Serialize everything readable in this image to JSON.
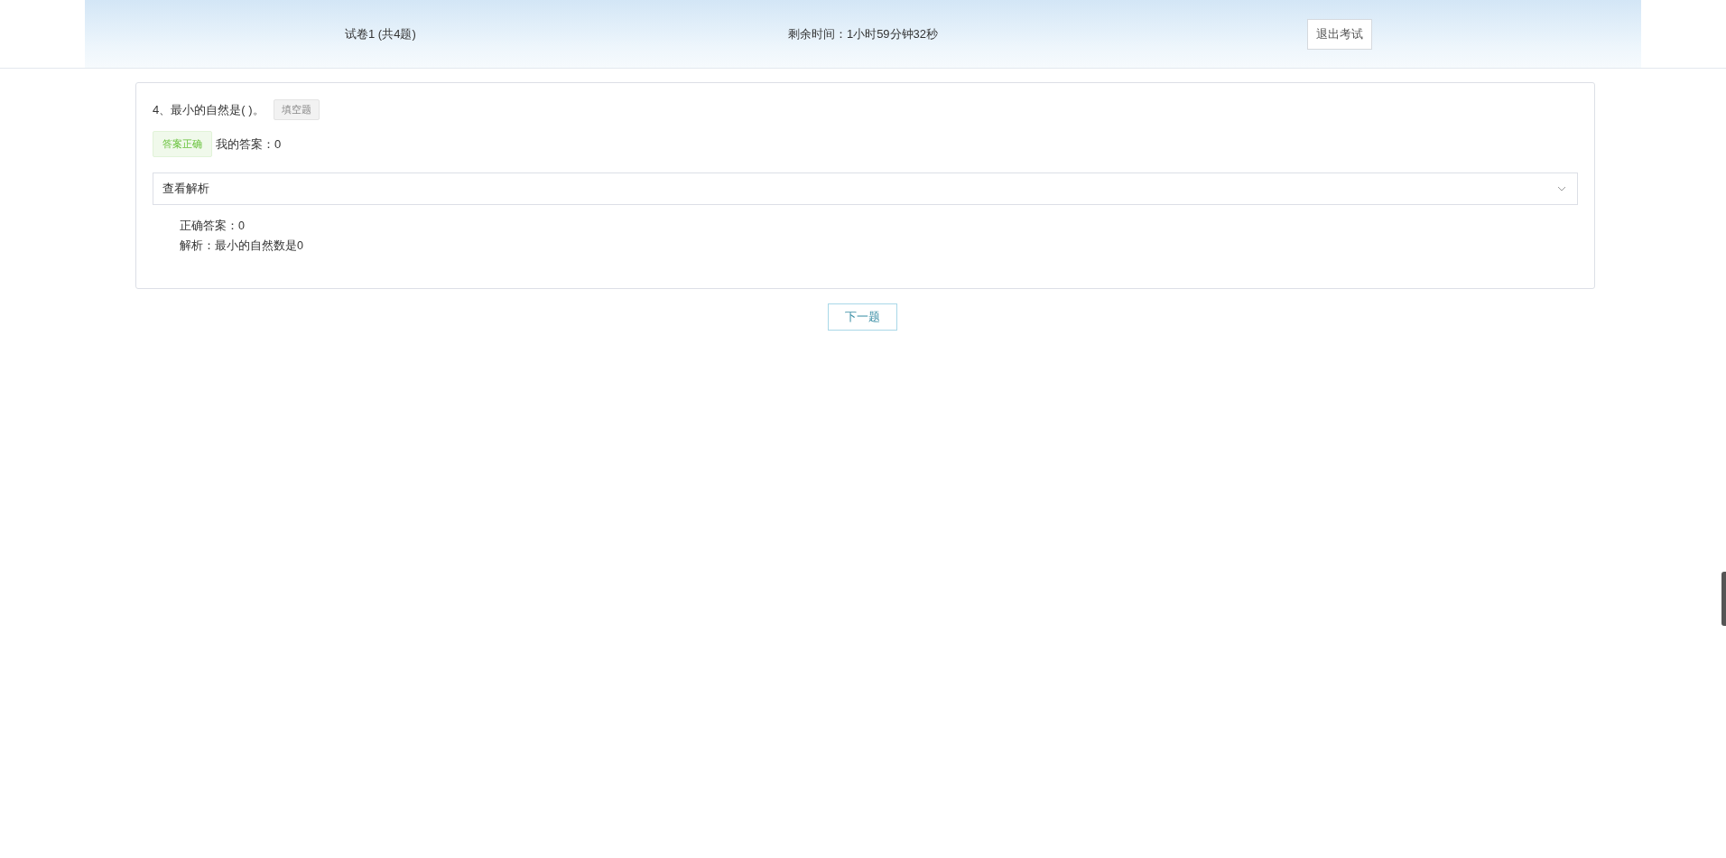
{
  "header": {
    "paper_title": "试卷1 (共4题)",
    "timer": "剩余时间：1小时59分钟32秒",
    "exit_button": "退出考试"
  },
  "question": {
    "text": "4、最小的自然是( )。",
    "type_tag": "填空题",
    "result": {
      "correct": true,
      "label": "答案正确"
    },
    "my_answer": "我的答案：0",
    "analysis": {
      "title": "查看解析",
      "expanded": true,
      "lines": [
        "正确答案：0",
        "解析：最小的自然数是0"
      ]
    }
  },
  "next_button": "下一题"
}
